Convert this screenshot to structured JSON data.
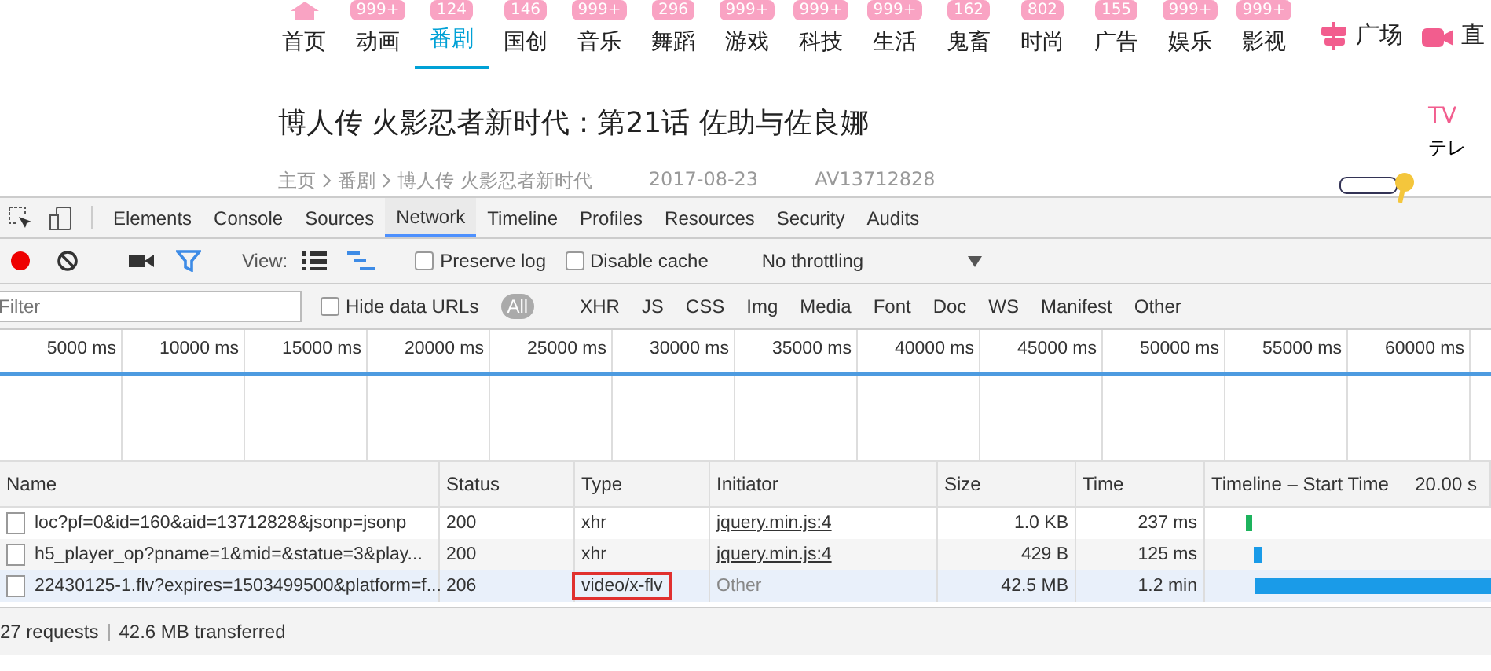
{
  "nav": {
    "items": [
      {
        "label": "首页",
        "selected": false
      },
      {
        "label": "动画",
        "badge": "999+",
        "selected": false
      },
      {
        "label": "番剧",
        "badge": "124",
        "selected": true
      },
      {
        "label": "国创",
        "badge": "146",
        "selected": false
      },
      {
        "label": "音乐",
        "badge": "999+",
        "selected": false
      },
      {
        "label": "舞蹈",
        "badge": "296",
        "selected": false
      },
      {
        "label": "游戏",
        "badge": "999+",
        "selected": false
      },
      {
        "label": "科技",
        "badge": "999+",
        "selected": false
      },
      {
        "label": "生活",
        "badge": "999+",
        "selected": false
      },
      {
        "label": "鬼畜",
        "badge": "162",
        "selected": false
      },
      {
        "label": "时尚",
        "badge": "802",
        "selected": false
      },
      {
        "label": "广告",
        "badge": "155",
        "selected": false
      },
      {
        "label": "娱乐",
        "badge": "999+",
        "selected": false
      },
      {
        "label": "影视",
        "badge": "999+",
        "selected": false
      }
    ],
    "extras": [
      {
        "kind": "square",
        "label": "广场"
      },
      {
        "kind": "live",
        "label": "直"
      }
    ]
  },
  "video": {
    "title": "博人传 火影忍者新时代 : 第21话 佐助与佐良娜",
    "breadcrumb": [
      "主页",
      "番剧",
      "博人传 火影忍者新时代"
    ],
    "date": "2017-08-23",
    "av": "AV13712828",
    "channel": "TV",
    "channel_sub": "テレ"
  },
  "devtools": {
    "tabs": [
      {
        "label": "Elements",
        "selected": false
      },
      {
        "label": "Console",
        "selected": false
      },
      {
        "label": "Sources",
        "selected": false
      },
      {
        "label": "Network",
        "selected": true
      },
      {
        "label": "Timeline",
        "selected": false
      },
      {
        "label": "Profiles",
        "selected": false
      },
      {
        "label": "Resources",
        "selected": false
      },
      {
        "label": "Security",
        "selected": false
      },
      {
        "label": "Audits",
        "selected": false
      }
    ],
    "toolbar": {
      "recording": true,
      "filter_on": true,
      "view_label": "View:",
      "large_rows": false,
      "waterfall_on": true,
      "options": [
        {
          "label": "Preserve log",
          "checked": false
        },
        {
          "label": "Disable cache",
          "checked": false
        }
      ],
      "throttling": "No throttling"
    },
    "filter": {
      "placeholder": "Filter",
      "hide_data_urls": {
        "label": "Hide data URLs",
        "checked": false
      },
      "types": [
        {
          "label": "All",
          "selected": true
        },
        {
          "label": "XHR",
          "selected": false
        },
        {
          "label": "JS",
          "selected": false
        },
        {
          "label": "CSS",
          "selected": false
        },
        {
          "label": "Img",
          "selected": false
        },
        {
          "label": "Media",
          "selected": false
        },
        {
          "label": "Font",
          "selected": false
        },
        {
          "label": "Doc",
          "selected": false
        },
        {
          "label": "WS",
          "selected": false
        },
        {
          "label": "Manifest",
          "selected": false
        },
        {
          "label": "Other",
          "selected": false
        }
      ]
    },
    "overview_ticks": [
      "5000 ms",
      "10000 ms",
      "15000 ms",
      "20000 ms",
      "25000 ms",
      "30000 ms",
      "35000 ms",
      "40000 ms",
      "45000 ms",
      "50000 ms",
      "55000 ms",
      "60000 ms"
    ],
    "table": {
      "columns": [
        "Name",
        "Status",
        "Type",
        "Initiator",
        "Size",
        "Time",
        "Timeline – Start Time"
      ],
      "timeline_tick": "20.00 s",
      "rows": [
        {
          "name": "loc?pf=0&id=160&aid=13712828&jsonp=jsonp",
          "status": "200",
          "type": "xhr",
          "initiator": "jquery.min.js:4",
          "initiator_link": true,
          "size": "1.0 KB",
          "time": "237 ms",
          "selected": false,
          "type_highlighted": false
        },
        {
          "name": "h5_player_op?pname=1&mid=&statue=3&play...",
          "status": "200",
          "type": "xhr",
          "initiator": "jquery.min.js:4",
          "initiator_link": true,
          "size": "429 B",
          "time": "125 ms",
          "selected": false,
          "type_highlighted": false
        },
        {
          "name": "22430125-1.flv?expires=1503499500&platform=f...",
          "status": "206",
          "type": "video/x-flv",
          "initiator": "Other",
          "initiator_link": false,
          "size": "42.5 MB",
          "time": "1.2 min",
          "selected": true,
          "type_highlighted": true
        }
      ]
    },
    "status": [
      "27 requests",
      "42.6 MB transferred"
    ]
  }
}
